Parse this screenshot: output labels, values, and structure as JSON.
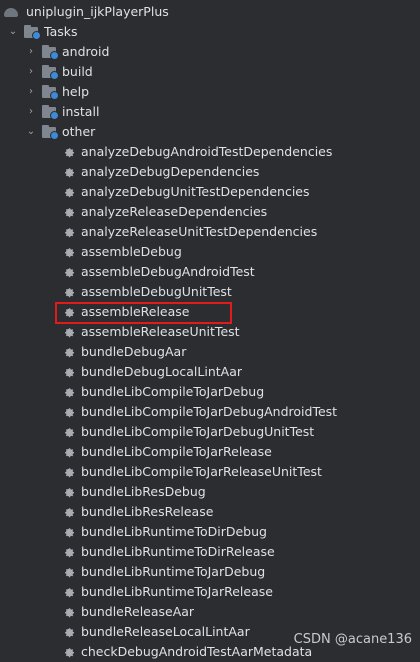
{
  "project": {
    "name": "uniplugin_ijkPlayerPlus"
  },
  "tasks_root": {
    "label": "Tasks"
  },
  "groups": [
    {
      "label": "android"
    },
    {
      "label": "build"
    },
    {
      "label": "help"
    },
    {
      "label": "install"
    },
    {
      "label": "other"
    }
  ],
  "other_tasks": [
    "analyzeDebugAndroidTestDependencies",
    "analyzeDebugDependencies",
    "analyzeDebugUnitTestDependencies",
    "analyzeReleaseDependencies",
    "analyzeReleaseUnitTestDependencies",
    "assembleDebug",
    "assembleDebugAndroidTest",
    "assembleDebugUnitTest",
    "assembleRelease",
    "assembleReleaseUnitTest",
    "bundleDebugAar",
    "bundleDebugLocalLintAar",
    "bundleLibCompileToJarDebug",
    "bundleLibCompileToJarDebugAndroidTest",
    "bundleLibCompileToJarDebugUnitTest",
    "bundleLibCompileToJarRelease",
    "bundleLibCompileToJarReleaseUnitTest",
    "bundleLibResDebug",
    "bundleLibResRelease",
    "bundleLibRuntimeToDirDebug",
    "bundleLibRuntimeToDirRelease",
    "bundleLibRuntimeToJarDebug",
    "bundleLibRuntimeToJarRelease",
    "bundleReleaseAar",
    "bundleReleaseLocalLintAar",
    "checkDebugAndroidTestAarMetadata"
  ],
  "watermark": "CSDN @acane136",
  "colors": {
    "background": "#2b2d30",
    "text": "#dfe1e5",
    "highlight_border": "#e11b1b",
    "accent": "#3d8ad6"
  }
}
